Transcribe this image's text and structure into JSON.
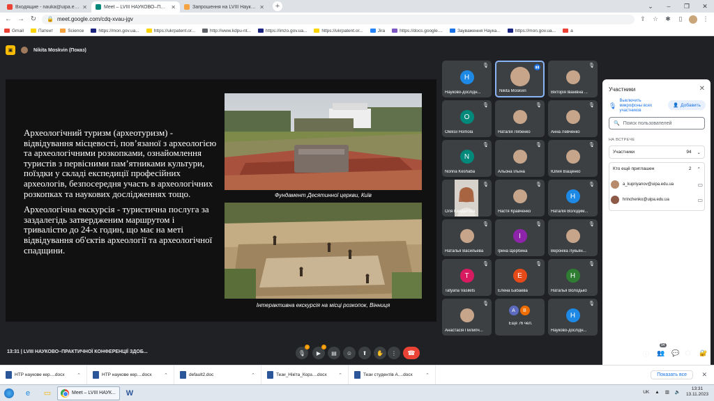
{
  "browser": {
    "tabs": [
      {
        "title": "Входящие - nauka@uipa.edu.ua",
        "color": "#ea4335",
        "active": false
      },
      {
        "title": "Meet – LVIII НАУКОВО–ПРАКТИЧ...",
        "color": "#00897b",
        "active": true
      },
      {
        "title": "Запрошення на LVIII Науково-п...",
        "color": "#f4a340",
        "active": false
      }
    ],
    "url": "meet.google.com/cdq-xvau-jgv",
    "bookmarks": [
      {
        "label": "Gmail",
        "color": "#ea4335"
      },
      {
        "label": "Патент",
        "color": "#ffd500"
      },
      {
        "label": "Science",
        "color": "#f4a340"
      },
      {
        "label": "https://mon.gov.ua...",
        "color": "#1a237e"
      },
      {
        "label": "https://ukrpatent.or...",
        "color": "#ffd500"
      },
      {
        "label": "http://www.kdpu-nt...",
        "color": "#5f6368"
      },
      {
        "label": "https://imzo.gov.ua...",
        "color": "#1a237e"
      },
      {
        "label": "https://ukrpatent.or...",
        "color": "#ffd500"
      },
      {
        "label": "Jira",
        "color": "#2684ff"
      },
      {
        "label": "https://docs.google....",
        "color": "#7e57c2"
      },
      {
        "label": "Зауваження Наука...",
        "color": "#1a73e8"
      },
      {
        "label": "https://mon.gov.ua...",
        "color": "#1a237e"
      },
      {
        "label": "a",
        "color": "#ea4335"
      }
    ]
  },
  "meet": {
    "presenter": "Nikita Moskvin (Показ)",
    "slide": {
      "paragraph1": "Археологічний туризм (археотуризм) - відвідування місцевості, пов’язаної з археологією та археологічними розкопками, ознайомлення туристів з первісними пам’ятниками культури, поїздки у складі експедиції професійних археологів, безпосередня участь в археологічних розкопках та наукових дослідженнях тощо.",
      "paragraph2": "Археологічна екскурсія - туристична послуга за заздалегідь затвердженим маршрутом і тривалістю до 24-х годин, що має на меті відвідування об'єктів археології та археологічної спадщини.",
      "caption1": "Фундамент Десятинної церкви, Київ",
      "caption2": "Інтерактивна екскурсія на місці розкопок, Вінниця"
    },
    "tiles": [
      {
        "name": "Науково-дослідн...",
        "initial": "H",
        "color": "#1e88e5",
        "photo": false
      },
      {
        "name": "Nikita Moskvin",
        "initial": "",
        "color": "",
        "photo": true,
        "speaking": true
      },
      {
        "name": "Вікторія Іванівна ...",
        "initial": "",
        "color": "",
        "photo": true
      },
      {
        "name": "Oleksii Homola",
        "initial": "O",
        "color": "#00897b",
        "photo": false
      },
      {
        "name": "Наталія Лябенко",
        "initial": "",
        "color": "",
        "photo": true
      },
      {
        "name": "Анна Левченко",
        "initial": "",
        "color": "",
        "photo": true
      },
      {
        "name": "Nonna Keshaba",
        "initial": "N",
        "color": "#00897b",
        "photo": false
      },
      {
        "name": "Альона Ільїна",
        "initial": "",
        "color": "",
        "photo": true
      },
      {
        "name": "Юлия Ващенко",
        "initial": "",
        "color": "",
        "photo": true
      },
      {
        "name": "Оля Кайдалова",
        "initial": "",
        "color": "",
        "photo": true,
        "camera": true
      },
      {
        "name": "Настя Кравченко",
        "initial": "",
        "color": "",
        "photo": true
      },
      {
        "name": "Наталія Володим...",
        "initial": "H",
        "color": "#1e88e5",
        "photo": false
      },
      {
        "name": "Наталья Васильева",
        "initial": "",
        "color": "",
        "photo": true
      },
      {
        "name": "Ірина Щербина",
        "initial": "I",
        "color": "#8e24aa",
        "photo": false
      },
      {
        "name": "Вероніка Лукьян...",
        "initial": "",
        "color": "",
        "photo": true
      },
      {
        "name": "Tatyana Vasilets",
        "initial": "T",
        "color": "#d81b60",
        "photo": false
      },
      {
        "name": "Елена Бабаева",
        "initial": "E",
        "color": "#e64a19",
        "photo": false
      },
      {
        "name": "Наталья Володько",
        "initial": "H",
        "color": "#2e7d32",
        "photo": false
      },
      {
        "name": "Анастасія Пилипч...",
        "initial": "",
        "color": "",
        "photo": true
      },
      {
        "name": "Ещё 76 чел.",
        "initial": "A",
        "color": "#5c6bc0",
        "photo": false,
        "more": true
      },
      {
        "name": "Науково-дослідн...",
        "initial": "H",
        "color": "#1e88e5",
        "photo": false
      }
    ],
    "meeting_title": "13:31  |  LVIII НАУКОВО–ПРАКТИЧНОЇ КОНФЕРЕНЦІЇ ЗДОБ...",
    "participant_count_badge": "94",
    "controls": {
      "mic": "mic-off-icon",
      "cam": "cam-off-icon",
      "hangup": "hang-up-icon"
    }
  },
  "panel": {
    "title": "Участники",
    "mute_all": "Выключить микрофоны всех участников",
    "add": "Добавить",
    "search_placeholder": "Поиск пользователей",
    "section": "НА ВСТРЕЧЕ",
    "participants_label": "Участники",
    "participants_count": "94",
    "invited_label": "Кто ещё приглашен",
    "invited_count": "2",
    "invited": [
      {
        "email": "a_kupriyanov@uipa.edu.ua"
      },
      {
        "email": "hrinchenko@uipa.edu.ua"
      }
    ]
  },
  "downloads": {
    "items": [
      "НТР наукове кер....docx",
      "НТР наукове кер....docx",
      "default2.doc",
      "Тези_Нікіта_Корз....docx",
      "Тези студентів А....docx"
    ],
    "show_all": "Показать все"
  },
  "taskbar": {
    "active_window": "Meet – LVIII НАУК...",
    "lang": "UK",
    "time": "13:31",
    "date": "13.11.2023"
  }
}
